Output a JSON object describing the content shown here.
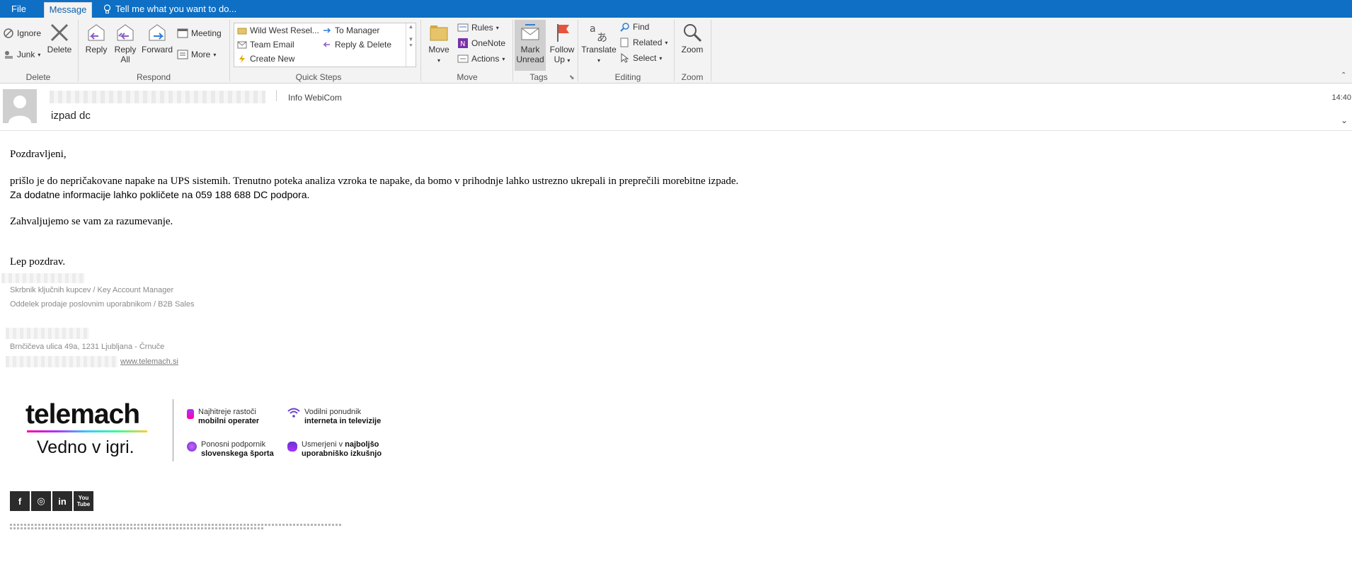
{
  "tabs": {
    "file": "File",
    "message": "Message",
    "tell_me": "Tell me what you want to do..."
  },
  "ribbon": {
    "delete_group": {
      "label": "Delete",
      "ignore": "Ignore",
      "junk": "Junk",
      "delete": "Delete"
    },
    "respond_group": {
      "label": "Respond",
      "reply": "Reply",
      "reply_all_1": "Reply",
      "reply_all_2": "All",
      "forward": "Forward",
      "meeting": "Meeting",
      "more": "More"
    },
    "quick_steps": {
      "label": "Quick Steps",
      "items": [
        "Wild West Resel...",
        "Team Email",
        "Create New",
        "To Manager",
        "Reply & Delete"
      ]
    },
    "move_group": {
      "label": "Move",
      "move": "Move",
      "rules": "Rules",
      "onenote": "OneNote",
      "actions": "Actions"
    },
    "tags_group": {
      "label": "Tags",
      "mark_unread_1": "Mark",
      "mark_unread_2": "Unread",
      "follow_up_1": "Follow",
      "follow_up_2": "Up"
    },
    "editing_group": {
      "label": "Editing",
      "translate": "Translate",
      "find": "Find",
      "related": "Related",
      "select": "Select"
    },
    "zoom_group": {
      "label": "Zoom",
      "zoom": "Zoom"
    }
  },
  "message": {
    "to": "Info WebiCom",
    "subject": "izpad dc",
    "time": "14:40"
  },
  "body": {
    "greeting": "Pozdravljeni,",
    "line1": "prišlo je do nepričakovane napake na UPS sistemih. Trenutno poteka analiza vzroka te napake, da bomo v prihodnje lahko ustrezno ukrepali in preprečili morebitne izpade.",
    "line2": "Za dodatne informacije lahko pokličete na 059 188 688 DC podpora.",
    "thanks": "Zahvaljujemo se vam za razumevanje.",
    "closing": "Lep pozdrav."
  },
  "signature": {
    "role": "Skrbnik ključnih kupcev / Key Account Manager",
    "dept": "Oddelek prodaje poslovnim uporabnikom / B2B Sales",
    "address": "Brnčičeva ulica 49a, 1231 Ljubljana - Črnuče",
    "website": "www.telemach.si"
  },
  "banner": {
    "brand": "telemach",
    "slogan": "Vedno v igri.",
    "f1_a": "Najhitreje rastoči",
    "f1_b": "mobilni operater",
    "f2_a": "Vodilni ponudnik",
    "f2_b": "interneta in televizije",
    "f3_a": "Ponosni podpornik",
    "f3_b": "slovenskega športa",
    "f4_a": "Usmerjeni v ",
    "f4_a_bold": "najboljšo",
    "f4_b": "uporabniško izkušnjo"
  },
  "social": {
    "facebook": "f",
    "instagram": "◎",
    "linkedin": "in",
    "youtube": "You Tube"
  },
  "colors": {
    "accent": "#0e6fc4",
    "ribbon_bg": "#f3f3f3"
  }
}
